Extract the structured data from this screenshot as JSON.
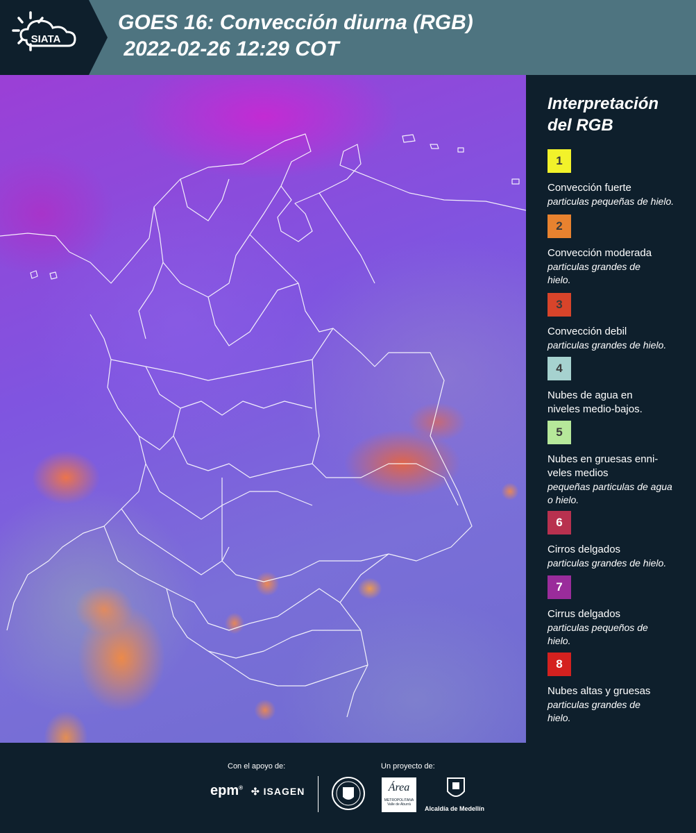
{
  "header": {
    "logo_text": "SIATA",
    "title_line1": "GOES 16: Convección diurna (RGB)",
    "title_line2": " 2022-02-26 12:29 COT"
  },
  "legend": {
    "title_line1": "Interpretación",
    "title_line2": "del RGB",
    "items": [
      {
        "number": "1",
        "color": "#f2f22a",
        "main": "Convección fuerte",
        "sub": "particulas pequeñas de hielo."
      },
      {
        "number": "2",
        "color": "#e8822f",
        "main": "Convección moderada",
        "sub": "particulas grandes de hielo."
      },
      {
        "number": "3",
        "color": "#d8442a",
        "main": "Convección debil",
        "sub": "particulas grandes de hielo."
      },
      {
        "number": "4",
        "color": "#a6d2cf",
        "main": "Nubes de agua en niveles medio-bajos.",
        "sub": ""
      },
      {
        "number": "5",
        "color": "#b6e89a",
        "main": "Nubes en gruesas enni-veles medios",
        "sub": "pequeñas particulas de agua o hielo."
      },
      {
        "number": "6",
        "color": "#b8314f",
        "main": "Cirros delgados",
        "sub": "particulas grandes de hielo."
      },
      {
        "number": "7",
        "color": "#9a2c9b",
        "main": "Cirrus delgados",
        "sub": "particulas pequeños de hielo."
      },
      {
        "number": "8",
        "color": "#d4211f",
        "main": "Nubes altas y gruesas",
        "sub": "particulas grandes de hielo."
      }
    ]
  },
  "footer": {
    "support_label": "Con el apoyo de:",
    "project_label": "Un proyecto de:",
    "epm_text": "epm",
    "epm_mark": "®",
    "isagen_text": "ISAGEN",
    "area_text": "Área",
    "area_sub1": "METROPOLITANA",
    "area_sub2": "Valle de Aburrá",
    "alcaldia_text": "Alcaldía de Medellín"
  },
  "colors": {
    "header_bg": "#4e7480",
    "logo_bg": "#0e1f2c",
    "panel_bg": "#0e1f2c"
  }
}
